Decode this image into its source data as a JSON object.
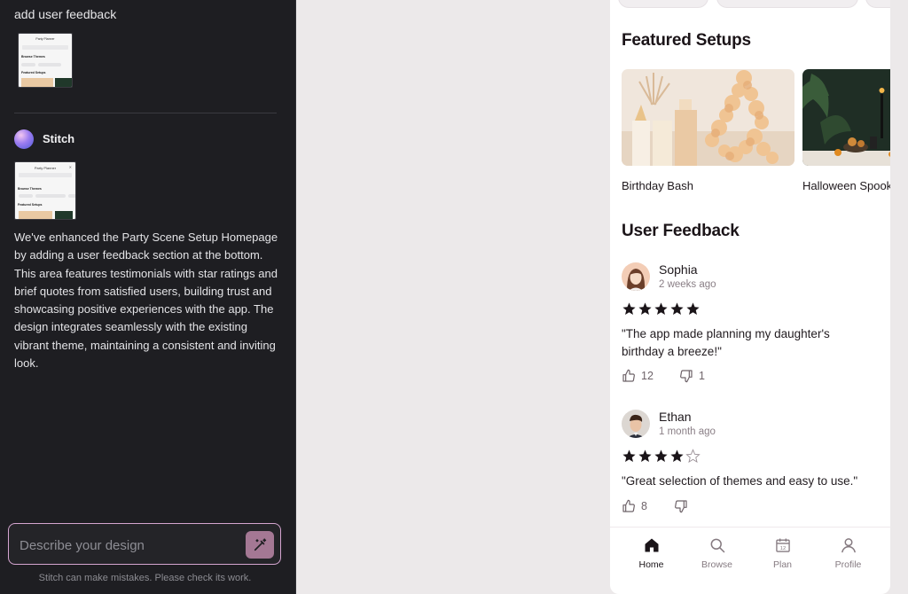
{
  "chat": {
    "user_message": "add user feedback",
    "assistant_name": "Stitch",
    "assistant_reply": "We've enhanced the Party Scene Setup Homepage by adding a user feedback section at the bottom. This area features testimonials with star ratings and brief quotes from satisfied users, building trust and showcasing positive experiences with the app. The design integrates seamlessly with the existing vibrant theme, maintaining a consistent and inviting look.",
    "input_placeholder": "Describe your design",
    "disclaimer": "Stitch can make mistakes. Please check its work."
  },
  "thumbnail": {
    "title": "Party Planner",
    "section1": "Browse Themes",
    "section2": "Featured Setups"
  },
  "app": {
    "featured_title": "Featured Setups",
    "featured": [
      {
        "label": "Birthday Bash"
      },
      {
        "label": "Halloween Spooktacular"
      }
    ],
    "feedback_title": "User Feedback",
    "feedback": [
      {
        "name": "Sophia",
        "time": "2 weeks ago",
        "rating": 5,
        "quote": "\"The app made planning my daughter's birthday a breeze!\"",
        "likes": "12",
        "dislikes": "1"
      },
      {
        "name": "Ethan",
        "time": "1 month ago",
        "rating": 4,
        "quote": "\"Great selection of themes and easy to use.\"",
        "likes": "8",
        "dislikes": ""
      }
    ],
    "tabs": [
      {
        "label": "Home",
        "icon": "home-icon",
        "active": true
      },
      {
        "label": "Browse",
        "icon": "search-icon",
        "active": false
      },
      {
        "label": "Plan",
        "icon": "calendar-icon",
        "active": false
      },
      {
        "label": "Profile",
        "icon": "person-icon",
        "active": false
      }
    ]
  },
  "colors": {
    "panel_bg": "#1e1e22",
    "canvas_bg": "#ece9ea",
    "accent": "#a47894",
    "prompt_border": "#d4a5d0"
  }
}
